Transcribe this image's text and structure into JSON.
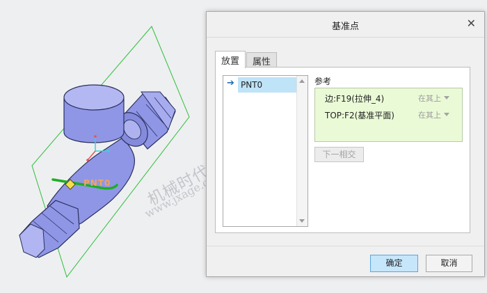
{
  "viewport": {
    "point_label": "PNT0",
    "watermark_cn": "机械时代网",
    "watermark_url": "www.jxage.com",
    "colors": {
      "part_fill": "#8f96e6",
      "part_stroke": "#2a2f5c",
      "datum_plane": "#2fbf3a",
      "selected_edge": "#1fae21",
      "point_label": "#f2a35e"
    }
  },
  "dialog": {
    "title": "基准点",
    "close_glyph": "✕",
    "tabs": [
      {
        "label": "放置",
        "active": true
      },
      {
        "label": "属性",
        "active": false
      }
    ],
    "points_list": {
      "items": [
        {
          "name": "PNT0",
          "selected": true
        }
      ]
    },
    "references": {
      "label": "参考",
      "rows": [
        {
          "ref": "边:F19(拉伸_4)",
          "constraint": "在其上"
        },
        {
          "ref": "TOP:F2(基准平面)",
          "constraint": "在其上"
        }
      ]
    },
    "next_intersect_label": "下一相交",
    "ok_label": "确定",
    "cancel_label": "取消"
  }
}
